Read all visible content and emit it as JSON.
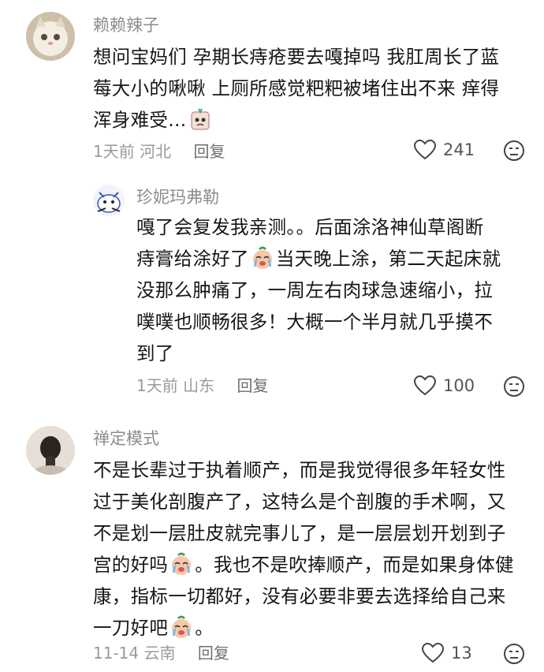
{
  "comments": [
    {
      "username": "赖赖辣子",
      "lines": [
        "想问宝妈们 孕期长痔疮要去嘎掉吗 我肛周长了蓝",
        "莓大小的啾啾 上厕所感觉粑粑被堵住出不来 痒得",
        "浑身难受..."
      ],
      "time": "1天前",
      "location": "河北",
      "reply_label": "回复",
      "likes": "241"
    },
    {
      "username": "珍妮玛弗勒",
      "lines": [
        "嘎了会复发我亲测。。后面涂洛神仙草阁断",
        "痔膏给涂好了",
        "当天晚上涂，第二天起床就",
        "没那么肿痛了，一周左右肉球急速缩小，拉",
        "噗噗也顺畅很多！大概一个半月就几乎摸不",
        "到了"
      ],
      "time": "1天前",
      "location": "山东",
      "reply_label": "回复",
      "likes": "100"
    },
    {
      "username": "禅定模式",
      "lines": [
        "不是长辈过于执着顺产，而是我觉得很多年轻女性",
        "过于美化剖腹产了，这特么是个剖腹的手术啊，又",
        "不是划一层肚皮就完事儿了，是一层层划开划到子",
        "宫的好吗",
        "。我也不是吹捧顺产，而是如果身体健",
        "康，指标一切都好，没有必要非要去选择给自己来",
        "一刀好吧",
        "。"
      ],
      "time": "11-14",
      "location": "云南",
      "reply_label": "回复",
      "likes": "13"
    }
  ],
  "icons": {
    "like": "heart-outline-icon",
    "dislike": "unhappy-face-icon",
    "emoji": "crying-face-emoji"
  },
  "colors": {
    "username": "#8d8d8d",
    "meta": "#9a9a9a",
    "body": "#161616"
  }
}
